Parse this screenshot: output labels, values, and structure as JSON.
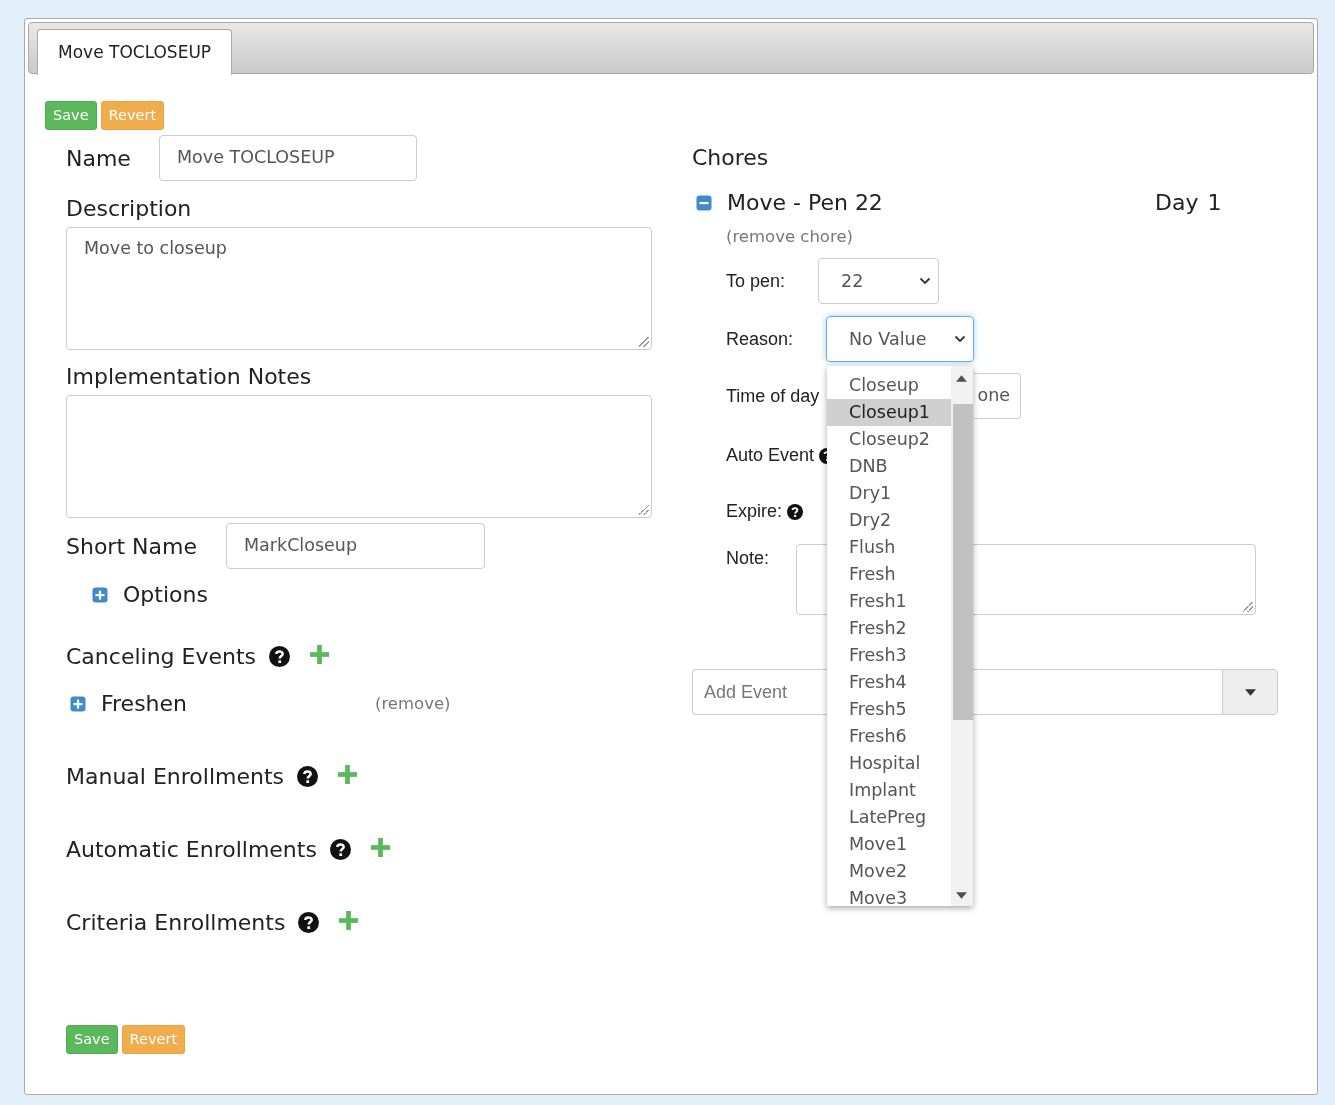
{
  "tab": {
    "label": "Move TOCLOSEUP",
    "selected": true
  },
  "top_buttons": [
    {
      "label": "Save",
      "kind": "save"
    },
    {
      "label": "Revert",
      "kind": "revert"
    }
  ],
  "name": {
    "label": "Name",
    "value": "Move TOCLOSEUP"
  },
  "description": {
    "label": "Description",
    "value": "Move to closeup"
  },
  "implementation_notes": {
    "label": "Implementation Notes"
  },
  "short_name": {
    "label": "Short Name",
    "value": "MarkCloseup"
  },
  "options": {
    "label": "Options",
    "expanded": false
  },
  "sections": [
    {
      "title": "Canceling Events",
      "items": [
        {
          "label": "Freshen",
          "expanded": false,
          "remove": "(remove)"
        }
      ]
    },
    {
      "title": "Manual Enrollments"
    },
    {
      "title": "Automatic Enrollments"
    },
    {
      "title": "Criteria Enrollments"
    }
  ],
  "bottom_buttons": [
    {
      "label": "Save",
      "kind": "save"
    },
    {
      "label": "Revert",
      "kind": "revert"
    }
  ],
  "chores": {
    "title": "Chores",
    "chore": {
      "title": "Move - Pen 22",
      "expanded": true,
      "day_label": "Day",
      "day": "1",
      "remove": "(remove chore)",
      "fields": [
        {
          "kind": "select",
          "label": "To pen:",
          "value": "22"
        },
        {
          "kind": "select",
          "label": "Reason:",
          "value": "No Value",
          "open": true
        },
        {
          "kind": "input",
          "label": "Time of day",
          "value": "one"
        },
        {
          "kind": "help",
          "label": "Auto Event"
        },
        {
          "kind": "help",
          "label": "Expire:"
        },
        {
          "kind": "textarea",
          "label": "Note:"
        }
      ]
    },
    "add_event": {
      "placeholder": "Add Event"
    }
  },
  "reason_options": [
    {
      "label": "Closeup",
      "selected": false
    },
    {
      "label": "Closeup1",
      "selected": true
    },
    {
      "label": "Closeup2",
      "selected": false
    },
    {
      "label": "DNB",
      "selected": false
    },
    {
      "label": "Dry1",
      "selected": false
    },
    {
      "label": "Dry2",
      "selected": false
    },
    {
      "label": "Flush",
      "selected": false
    },
    {
      "label": "Fresh",
      "selected": false
    },
    {
      "label": "Fresh1",
      "selected": false
    },
    {
      "label": "Fresh2",
      "selected": false
    },
    {
      "label": "Fresh3",
      "selected": false
    },
    {
      "label": "Fresh4",
      "selected": false
    },
    {
      "label": "Fresh5",
      "selected": false
    },
    {
      "label": "Fresh6",
      "selected": false
    },
    {
      "label": "Hospital",
      "selected": false
    },
    {
      "label": "Implant",
      "selected": false
    },
    {
      "label": "LatePreg",
      "selected": false
    },
    {
      "label": "Move1",
      "selected": false
    },
    {
      "label": "Move2",
      "selected": false
    },
    {
      "label": "Move3",
      "selected": false
    }
  ]
}
